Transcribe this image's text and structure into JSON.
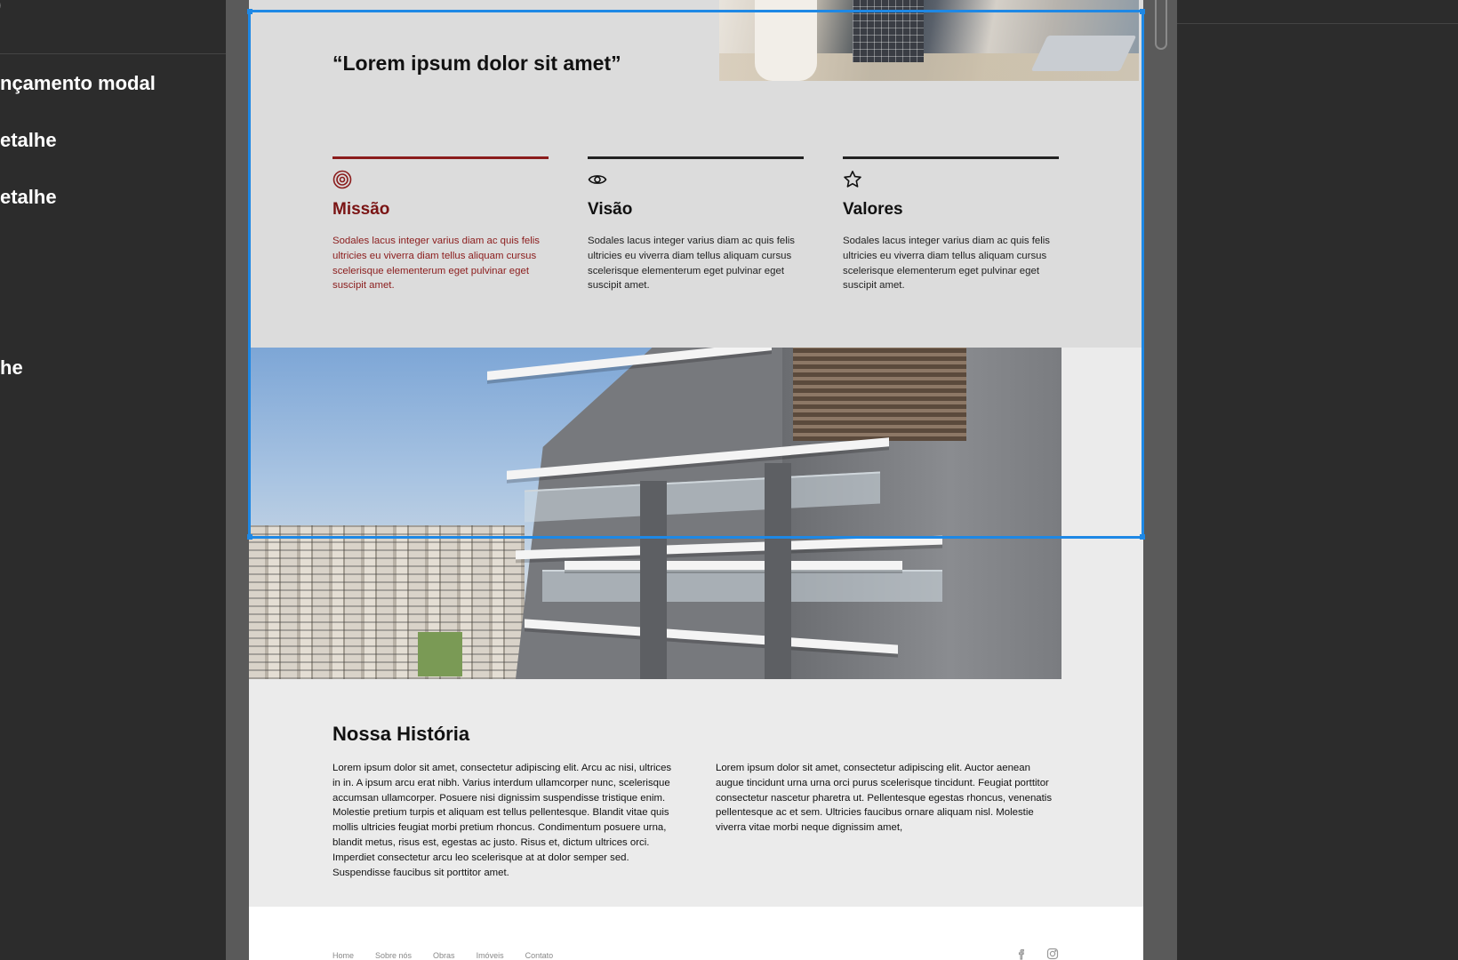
{
  "left_panel": {
    "items": [
      {
        "label": ")"
      },
      {
        "label": "nçamento modal"
      },
      {
        "label": "etalhe"
      },
      {
        "label": "etalhe"
      },
      {
        "label": "he"
      }
    ]
  },
  "page": {
    "quote": "“Lorem ipsum dolor sit amet”",
    "columns": [
      {
        "icon": "target-icon",
        "title": "Missão",
        "text": "Sodales lacus integer varius diam ac quis felis ultricies eu viverra diam tellus aliquam cursus scelerisque elementerum eget pulvinar eget suscipit amet."
      },
      {
        "icon": "eye-icon",
        "title": "Visão",
        "text": "Sodales lacus integer varius diam ac quis felis ultricies eu viverra diam tellus aliquam cursus scelerisque elementerum eget pulvinar eget suscipit amet."
      },
      {
        "icon": "star-icon",
        "title": "Valores",
        "text": "Sodales lacus integer varius diam ac quis felis ultricies eu viverra diam tellus aliquam cursus scelerisque elementerum eget pulvinar eget suscipit amet."
      }
    ],
    "historia": {
      "title": "Nossa História",
      "paragraph_left": "Lorem ipsum dolor sit amet, consectetur adipiscing elit. Arcu ac nisi, ultrices in in. A ipsum arcu erat nibh. Varius interdum ullamcorper nunc, scelerisque accumsan ullamcorper. Posuere nisi dignissim suspendisse tristique enim. Molestie pretium turpis et aliquam est tellus pellentesque. Blandit vitae quis mollis ultricies feugiat morbi pretium rhoncus. Condimentum posuere urna, blandit metus, risus est, egestas ac justo. Risus et, dictum ultrices orci. Imperdiet consectetur arcu leo scelerisque at at dolor semper sed. Suspendisse faucibus sit porttitor amet.",
      "paragraph_right": "Lorem ipsum dolor sit amet, consectetur adipiscing elit. Auctor aenean augue tincidunt urna urna orci purus scelerisque tincidunt. Feugiat porttitor consectetur nascetur pharetra ut. Pellentesque egestas rhoncus, venenatis pellentesque ac et sem. Ultricies faucibus ornare aliquam nisl. Molestie viverra vitae morbi neque dignissim amet,"
    },
    "footer": {
      "nav": [
        "Home",
        "Sobre nós",
        "Obras",
        "Imóveis",
        "Contato"
      ],
      "social": [
        "facebook-icon",
        "instagram-icon"
      ]
    }
  },
  "colors": {
    "accent": "#8b1c1c",
    "selection": "#1e88e5",
    "canvas": "#5a5a5a",
    "panel": "#2c2c2c"
  }
}
